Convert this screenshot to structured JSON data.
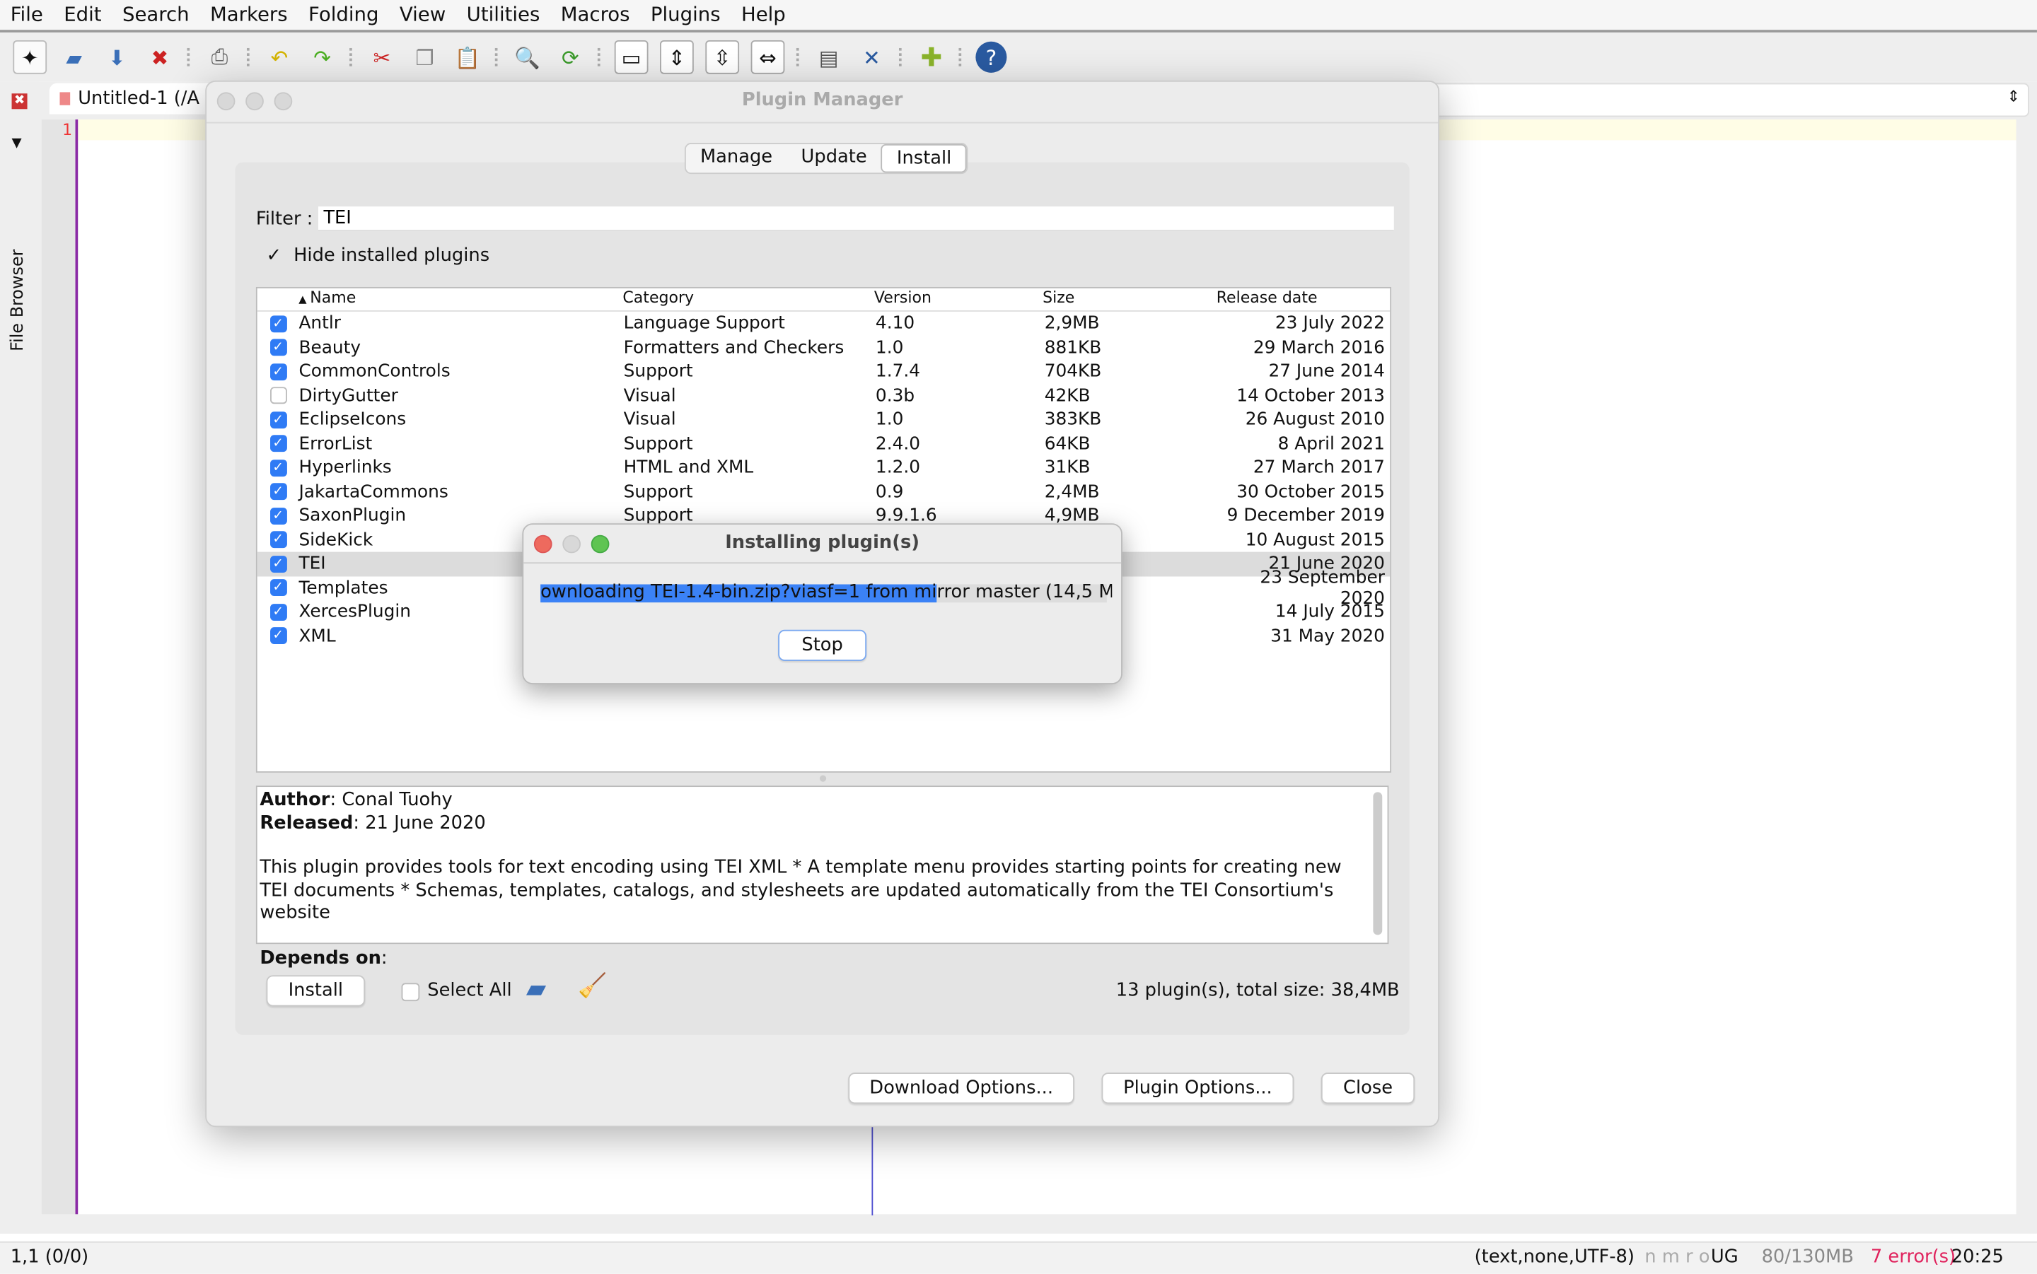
{
  "menu": [
    "File",
    "Edit",
    "Search",
    "Markers",
    "Folding",
    "View",
    "Utilities",
    "Macros",
    "Plugins",
    "Help"
  ],
  "toolbar_icons": [
    "new-file",
    "open-file",
    "save",
    "close-file",
    "print",
    "undo",
    "redo",
    "cut",
    "copy",
    "paste",
    "find",
    "find-replace",
    "new-view",
    "fold",
    "unfold",
    "expand",
    "buffer-options",
    "global-options",
    "plugin-manager",
    "help"
  ],
  "side": {
    "file_browser": "File Browser"
  },
  "editor": {
    "tab_title": "Untitled-1 (/A",
    "line_number": "1"
  },
  "status": {
    "position": "1,1 (0/0)",
    "mode": "(text,none,UTF-8)",
    "flags": "n m r o",
    "ug": "UG",
    "memory": "80/130MB",
    "errors": "7 error(s)",
    "time": "20:25",
    "error_color": "#e0245e"
  },
  "plugin_manager": {
    "title": "Plugin Manager",
    "tabs": [
      "Manage",
      "Update",
      "Install"
    ],
    "active_tab": "Install",
    "filter_label": "Filter :",
    "filter_value": "TEI",
    "hide_installed_label": "Hide installed plugins",
    "hide_installed": true,
    "columns": [
      "Name",
      "Category",
      "Version",
      "Size",
      "Release date"
    ],
    "rows": [
      {
        "checked": true,
        "name": "Antlr",
        "category": "Language Support",
        "version": "4.10",
        "size": "2,9MB",
        "date": "23 July 2022"
      },
      {
        "checked": true,
        "name": "Beauty",
        "category": "Formatters and Checkers",
        "version": "1.0",
        "size": "881KB",
        "date": "29 March 2016"
      },
      {
        "checked": true,
        "name": "CommonControls",
        "category": "Support",
        "version": "1.7.4",
        "size": "704KB",
        "date": "27 June 2014"
      },
      {
        "checked": false,
        "name": "DirtyGutter",
        "category": "Visual",
        "version": "0.3b",
        "size": "42KB",
        "date": "14 October 2013"
      },
      {
        "checked": true,
        "name": "EclipseIcons",
        "category": "Visual",
        "version": "1.0",
        "size": "383KB",
        "date": "26 August 2010"
      },
      {
        "checked": true,
        "name": "ErrorList",
        "category": "Support",
        "version": "2.4.0",
        "size": "64KB",
        "date": "8 April 2021"
      },
      {
        "checked": true,
        "name": "Hyperlinks",
        "category": "HTML and XML",
        "version": "1.2.0",
        "size": "31KB",
        "date": "27 March 2017"
      },
      {
        "checked": true,
        "name": "JakartaCommons",
        "category": "Support",
        "version": "0.9",
        "size": "2,4MB",
        "date": "30 October 2015"
      },
      {
        "checked": true,
        "name": "SaxonPlugin",
        "category": "Support",
        "version": "9.9.1.6",
        "size": "4,9MB",
        "date": "9 December 2019"
      },
      {
        "checked": true,
        "name": "SideKick",
        "category": "",
        "version": "",
        "size": "",
        "date": "10 August 2015"
      },
      {
        "checked": true,
        "name": "TEI",
        "category": "",
        "version": "",
        "size": "",
        "date": "21 June 2020",
        "selected": true
      },
      {
        "checked": true,
        "name": "Templates",
        "category": "",
        "version": "",
        "size": "",
        "date": "23 September 2020"
      },
      {
        "checked": true,
        "name": "XercesPlugin",
        "category": "",
        "version": "",
        "size": "",
        "date": "14 July 2015"
      },
      {
        "checked": true,
        "name": "XML",
        "category": "",
        "version": "",
        "size": "",
        "date": "31 May 2020"
      }
    ],
    "details": {
      "author_label": "Author",
      "author": ": Conal Tuohy",
      "released_label": "Released",
      "released": ": 21 June 2020",
      "description": "This plugin provides tools for text encoding using TEI XML * A template menu provides starting points for creating new TEI documents * Schemas, templates, catalogs, and stylesheets are updated automatically from the TEI Consortium's website",
      "depends_label": "Depends on",
      "depends": ":"
    },
    "install_label": "Install",
    "select_all_label": "Select All",
    "select_all": false,
    "summary": "13 plugin(s), total size: 38,4MB",
    "download_options": "Download Options...",
    "plugin_options": "Plugin Options...",
    "close": "Close"
  },
  "install_dialog": {
    "title": "Installing plugin(s)",
    "progress_text": "ownloading TEI-1.4-bin.zip?viasf=1 from mirror master (14,5 M",
    "progress_percent": 70,
    "stop": "Stop",
    "accent": "#3b82f6"
  }
}
